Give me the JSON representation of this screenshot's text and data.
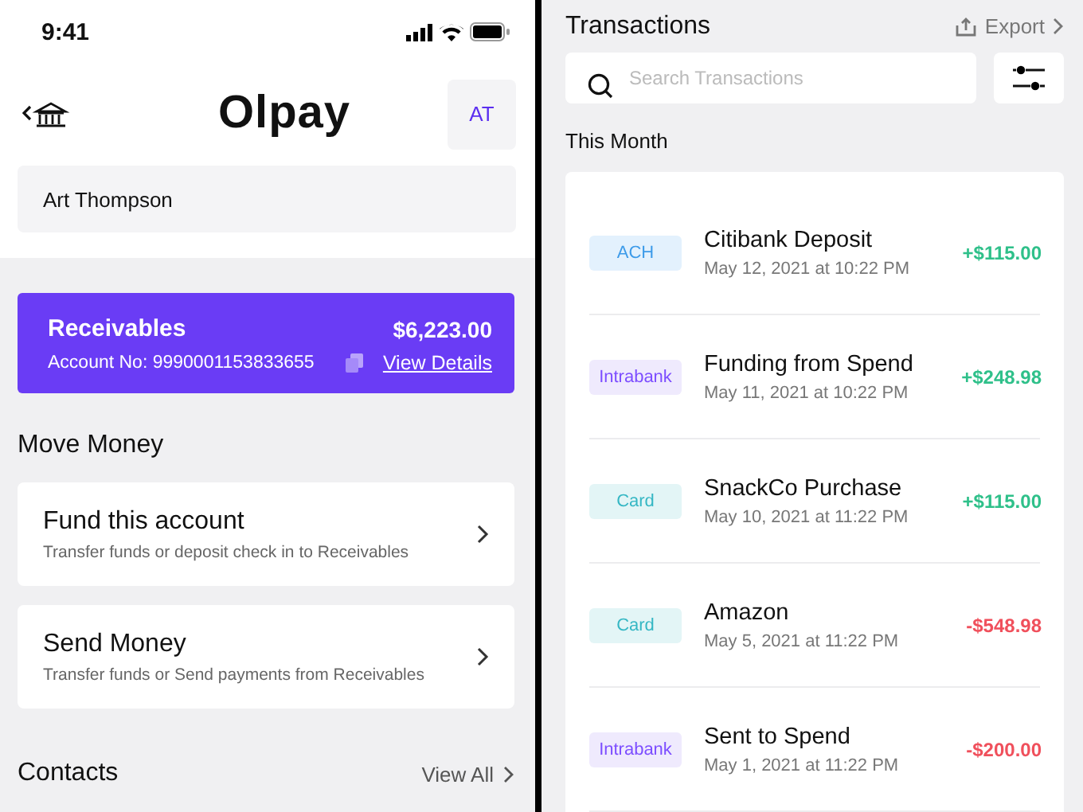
{
  "status_bar": {
    "time": "9:41"
  },
  "header": {
    "logo": "Olpay",
    "avatar": "AT"
  },
  "account_holder": "Art Thompson",
  "receivables": {
    "title": "Receivables",
    "balance": "$6,223.00",
    "account_no": "Account No: 9990001153833655",
    "link": "View Details"
  },
  "move_money": {
    "title": "Move Money",
    "actions": [
      {
        "title": "Fund this account",
        "subtitle": "Transfer funds or deposit check in to Receivables"
      },
      {
        "title": "Send Money",
        "subtitle": "Transfer funds or Send payments from Receivables"
      }
    ]
  },
  "contacts": {
    "title": "Contacts",
    "link": "View All"
  },
  "transactions": {
    "title": "Transactions",
    "export": "Export",
    "search": {
      "placeholder": "Search Transactions"
    },
    "section": "This Month",
    "rows": [
      {
        "tag": "ACH",
        "kind": "ach",
        "title": "Citibank Deposit",
        "date": "May 12, 2021 at 10:22 PM",
        "amount": "+$115.00",
        "color": "#2fc08a"
      },
      {
        "tag": "Intrabank",
        "kind": "intrabank",
        "title": "Funding from Spend",
        "date": "May 11, 2021 at 10:22 PM",
        "amount": "+$248.98",
        "color": "#2fc08a"
      },
      {
        "tag": "Card",
        "kind": "card",
        "title": "SnackCo Purchase",
        "date": "May 10, 2021 at 11:22 PM",
        "amount": "+$115.00",
        "color": "#2fc08a"
      },
      {
        "tag": "Card",
        "kind": "card",
        "title": "Amazon",
        "date": "May 5, 2021 at 11:22 PM",
        "amount": "-$548.98",
        "color": "#f0505c"
      },
      {
        "tag": "Intrabank",
        "kind": "intrabank",
        "title": "Sent to Spend",
        "date": "May 1, 2021 at 11:22 PM",
        "amount": "-$200.00",
        "color": "#f0505c"
      }
    ]
  }
}
